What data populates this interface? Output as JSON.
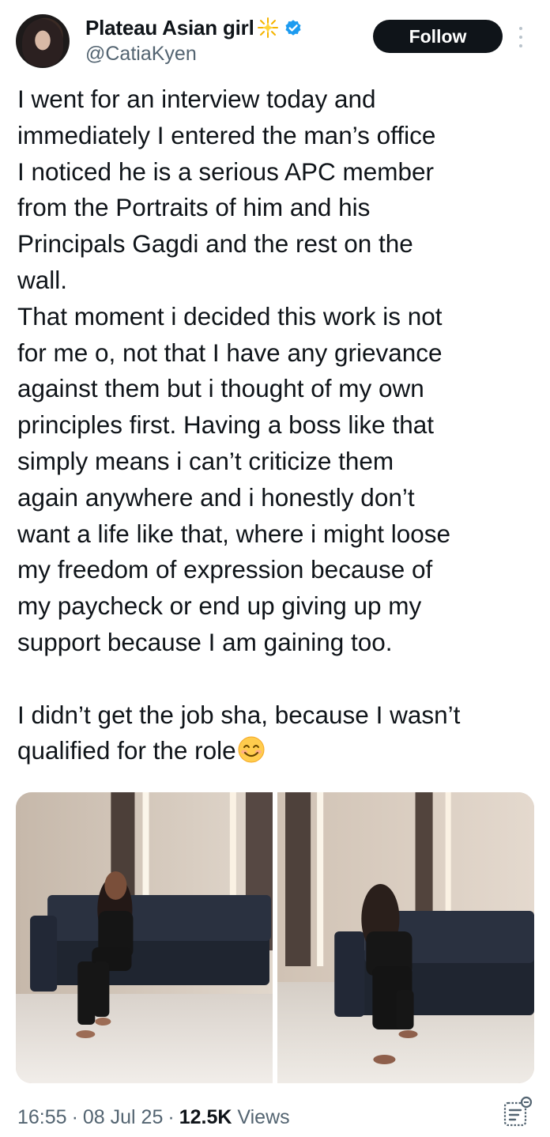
{
  "author": {
    "display_name": "Plateau Asian girl",
    "handle": "@CatiaKyen",
    "verified": true,
    "name_emoji": "sparkle-icon",
    "avatar": "avatar"
  },
  "follow_button": {
    "label": "Follow"
  },
  "tweet": {
    "lines": [
      "I went for an interview today and",
      "immediately I entered the man’s office",
      "I noticed he is a serious APC member",
      "from  the Portraits of him and his",
      "Principals Gagdi and the rest on the",
      "wall.",
      "That moment i decided this work is not",
      "for me o, not that I have any grievance",
      "against them but i thought of my own",
      "principles first. Having a boss like that",
      "simply means i can’t criticize them",
      "again anywhere and i honestly don’t",
      "want a life like that, where i might loose",
      "my freedom of expression because of",
      "my paycheck or end up giving up my",
      "support because I am gaining too.",
      "",
      "I didn’t get the job sha, because I wasn’t",
      "qualified for the role"
    ],
    "trailing_emoji": "smiling-face-icon"
  },
  "media": [
    {
      "name": "photo-1"
    },
    {
      "name": "photo-2"
    }
  ],
  "meta": {
    "time": "16:55",
    "separator": "·",
    "date": "08 Jul 25",
    "views_count": "12.5K",
    "views_label": "Views"
  },
  "colors": {
    "text": "#0f1419",
    "secondary": "#536471",
    "verified": "#1d9bf0",
    "button_bg": "#0f1419"
  }
}
